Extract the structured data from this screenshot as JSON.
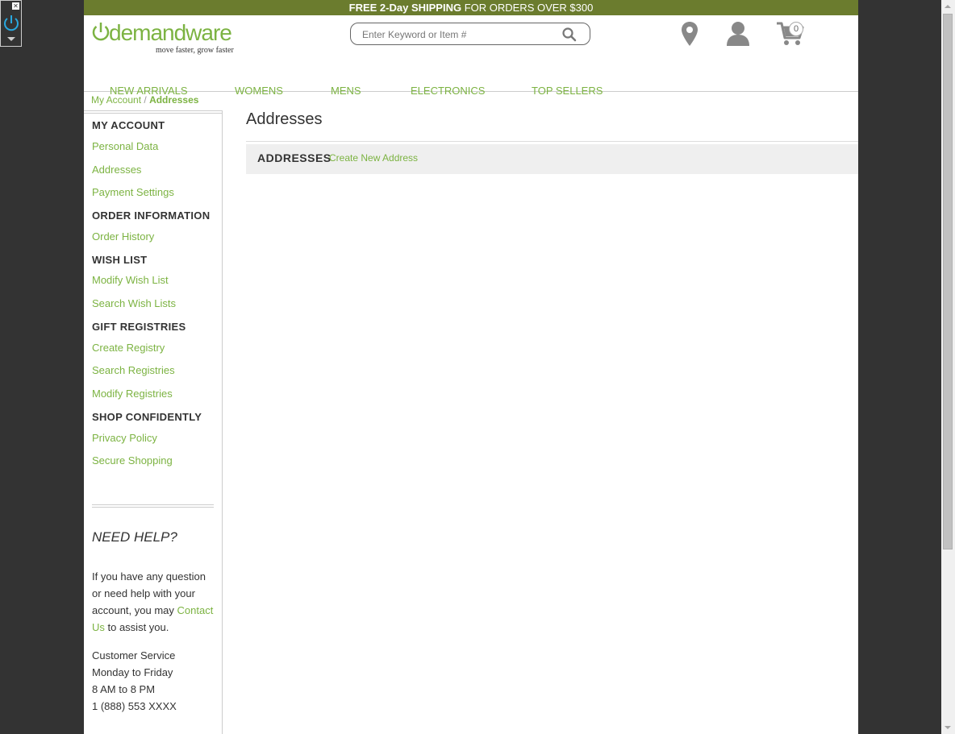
{
  "promo": {
    "part1": "FREE 2-Day SHIPPING",
    "part2": " FOR ORDERS OVER $300"
  },
  "brand": {
    "wordmark": "demandware",
    "tagline": "move faster, grow faster",
    "accent_color": "#7cb342",
    "promo_color": "#6b7c2e"
  },
  "search": {
    "placeholder": "Enter Keyword or Item #",
    "icon": "search-icon"
  },
  "header_icons": [
    "store-locator-icon",
    "account-icon",
    "cart-icon"
  ],
  "cart": {
    "count": "0"
  },
  "nav": {
    "items": [
      "NEW ARRIVALS",
      "WOMENS",
      "MENS",
      "ELECTRONICS",
      "TOP SELLERS"
    ]
  },
  "breadcrumb": {
    "parent": "My Account",
    "separator": "/",
    "current": "Addresses"
  },
  "sidebar": {
    "sections": [
      {
        "heading": "MY ACCOUNT",
        "links": [
          "Personal Data",
          "Addresses",
          "Payment Settings"
        ]
      },
      {
        "heading": "ORDER INFORMATION",
        "links": [
          "Order History"
        ]
      },
      {
        "heading": "WISH LIST",
        "links": [
          "Modify Wish List",
          "Search Wish Lists"
        ]
      },
      {
        "heading": "GIFT REGISTRIES",
        "links": [
          "Create Registry",
          "Search Registries",
          "Modify Registries"
        ]
      },
      {
        "heading": "SHOP CONFIDENTLY",
        "links": [
          "Privacy Policy",
          "Secure Shopping"
        ]
      }
    ],
    "help": {
      "title": "NEED HELP?",
      "text_before": "If you have any question or need help with your account, you may ",
      "contact_link": "Contact Us",
      "text_after": " to assist you."
    },
    "service": {
      "line1": "Customer Service",
      "line2": "Monday to Friday",
      "line3": "8 AM to 8 PM",
      "line4": "1 (888) 553 XXXX"
    }
  },
  "main": {
    "title": "Addresses",
    "panel_title": "ADDRESSES",
    "create_link": "Create New Address"
  }
}
